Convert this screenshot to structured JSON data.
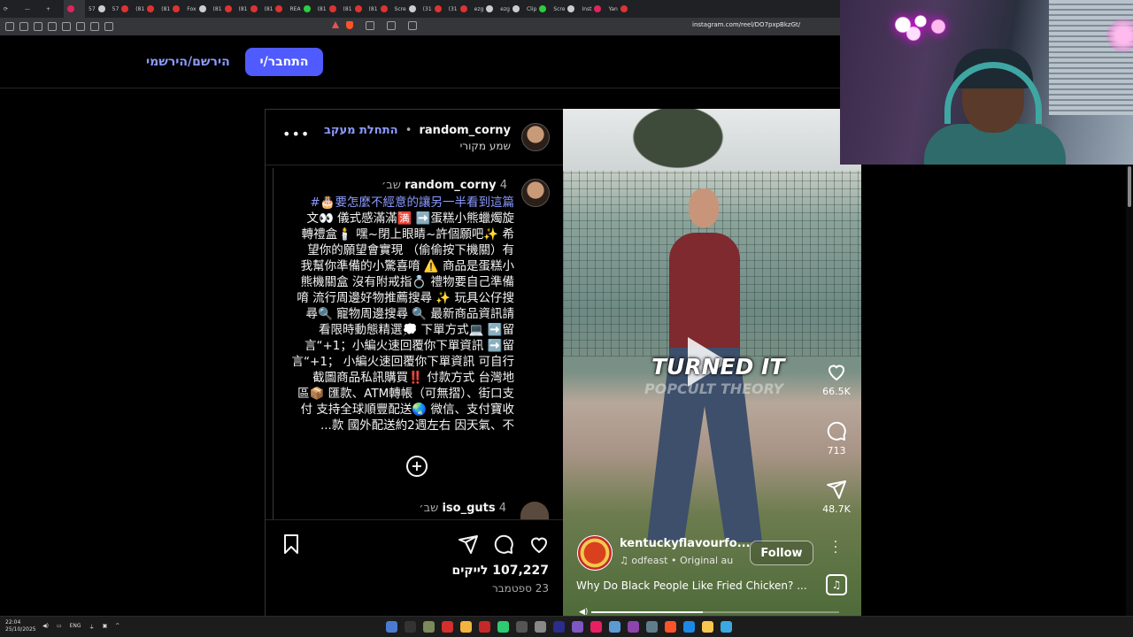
{
  "browser": {
    "url": "instagram.com/reel/DO7pxpBkzGt/",
    "tabs": [
      "57",
      "57",
      "(81",
      "(81",
      "Fox",
      "(81",
      "(81",
      "(81",
      "REA",
      "(81",
      "(81",
      "(81",
      "Scre",
      "(31",
      "(31",
      "ezg",
      "ezg",
      "Clip",
      "Scre",
      "Inst",
      "Yan"
    ]
  },
  "ig_header": {
    "login_label": "התחבר/י",
    "signup_label": "הירשם/הירשמי"
  },
  "post": {
    "username": "random_corny",
    "follow_label": "התחלת מעקב",
    "separator": "•",
    "audio_label": "שמע מקורי",
    "more_label": "•••",
    "caption_user": "random_corny",
    "caption_time": "4 שב׳",
    "caption_lines": [
      "要怎麼不經意的讓另一半看到這篇🎂#",
      "文👀 儀式感滿滿🈵 ➡️蛋糕小熊蠟燭旋",
      "轉禮盒🕯️ 嘿~閉上眼睛~許個願吧✨ 希",
      "望你的願望會實現 （偷偷按下機關）有",
      "我幫你準備的小驚喜唷 ⚠️ 商品是蛋糕小",
      "熊機關盒 沒有附戒指💍 禮物要自己準備",
      "唷 流行周邊好物推薦搜尋 ✨ 玩具公仔搜",
      "尋🔍 寵物周邊搜尋 🔍 最新商品資訊請",
      "看限時動態精選💭 下單方式💻 ➡️留",
      "言“+1；小編火速回覆你下單資訊 ➡️留",
      "言“+1； 小編火速回覆你下單資訊 可自行",
      "截圖商品私訊購買‼️ 付款方式 台灣地",
      "區📦 匯款、ATM轉帳（可無摺）、街口支",
      "付 支持全球順豐配送🌏 微信、支付寶收",
      "款 國外配送約2週左右 因天氣、不..."
    ],
    "plus_label": "+",
    "comment_user": "iso_guts",
    "comment_time": "4 שב׳",
    "likes": "107,227 לייקים",
    "date": "23 ספטמבר"
  },
  "reel": {
    "overlay_text": "TURNED IT",
    "overlay_sub": "POPCULT THEORY",
    "like_count": "66.5K",
    "comment_count": "713",
    "share_count": "48.7K",
    "username": "kentuckyflavourfo...",
    "audio": "odfeast • Original au",
    "follow_label": "Follow",
    "caption": "Why Do Black People Like Fried Chicken? ...",
    "progress": 0.45
  },
  "taskbar": {
    "time": "22:04",
    "date": "25/10/2025",
    "lang": "ENG"
  },
  "colors": {
    "ig_blue": "#4f5bff",
    "link_blue": "#8c9bff",
    "background": "#000000"
  }
}
